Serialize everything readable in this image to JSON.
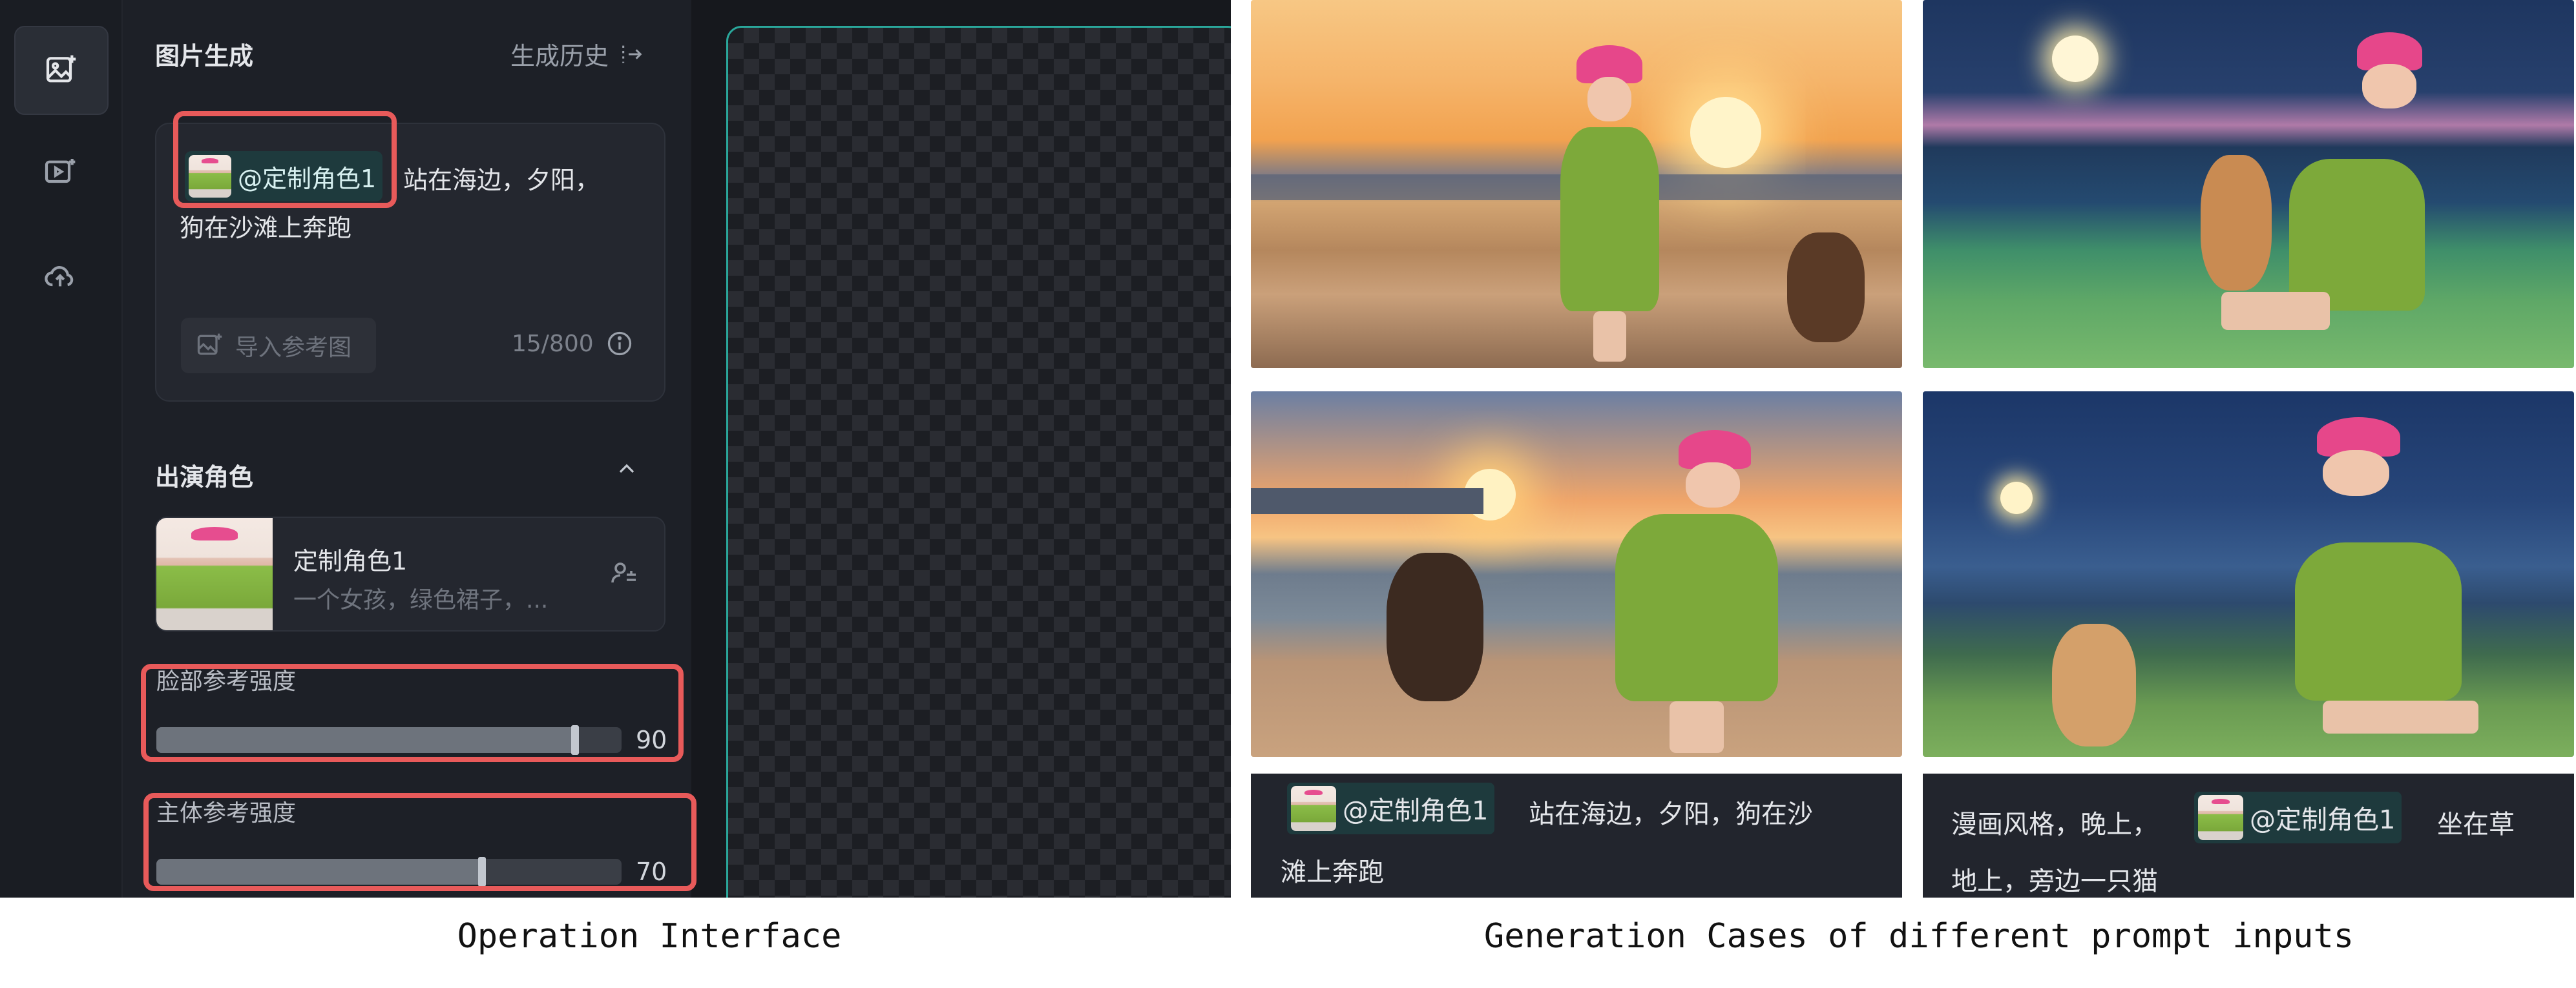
{
  "panel": {
    "title": "图片生成",
    "history_label": "生成历史",
    "prompt": {
      "mention_label": "@定制角色1",
      "text_line1": "站在海边，夕阳，",
      "text_line2": "狗在沙滩上奔跑",
      "import_label": "导入参考图",
      "char_count": "15/800"
    },
    "cast_section_title": "出演角色",
    "character": {
      "name": "定制角色1",
      "description": "一个女孩，绿色裙子，..."
    },
    "sliders": [
      {
        "label": "脸部参考强度",
        "value": "90",
        "fraction": 0.9
      },
      {
        "label": "主体参考强度",
        "value": "70",
        "fraction": 0.7
      }
    ]
  },
  "rail": {
    "items": [
      {
        "icon": "image-generate-icon",
        "active": true
      },
      {
        "icon": "video-generate-icon",
        "active": false
      },
      {
        "icon": "cloud-upload-icon",
        "active": false
      }
    ]
  },
  "cases": {
    "caption_left": {
      "mention": "@定制角色1",
      "line1": "站在海边，夕阳，狗在沙",
      "line2": "滩上奔跑"
    },
    "caption_right": {
      "prefix": "漫画风格，晚上，",
      "mention": "@定制角色1",
      "suffix": "坐在草",
      "line2": "地上，旁边一只猫"
    }
  },
  "captions": {
    "left": "Operation Interface",
    "right": "Generation Cases of different prompt inputs"
  },
  "colors": {
    "accent": "#2aa79b",
    "highlight_box": "#e85a5a",
    "panel_bg": "#1d2027"
  }
}
